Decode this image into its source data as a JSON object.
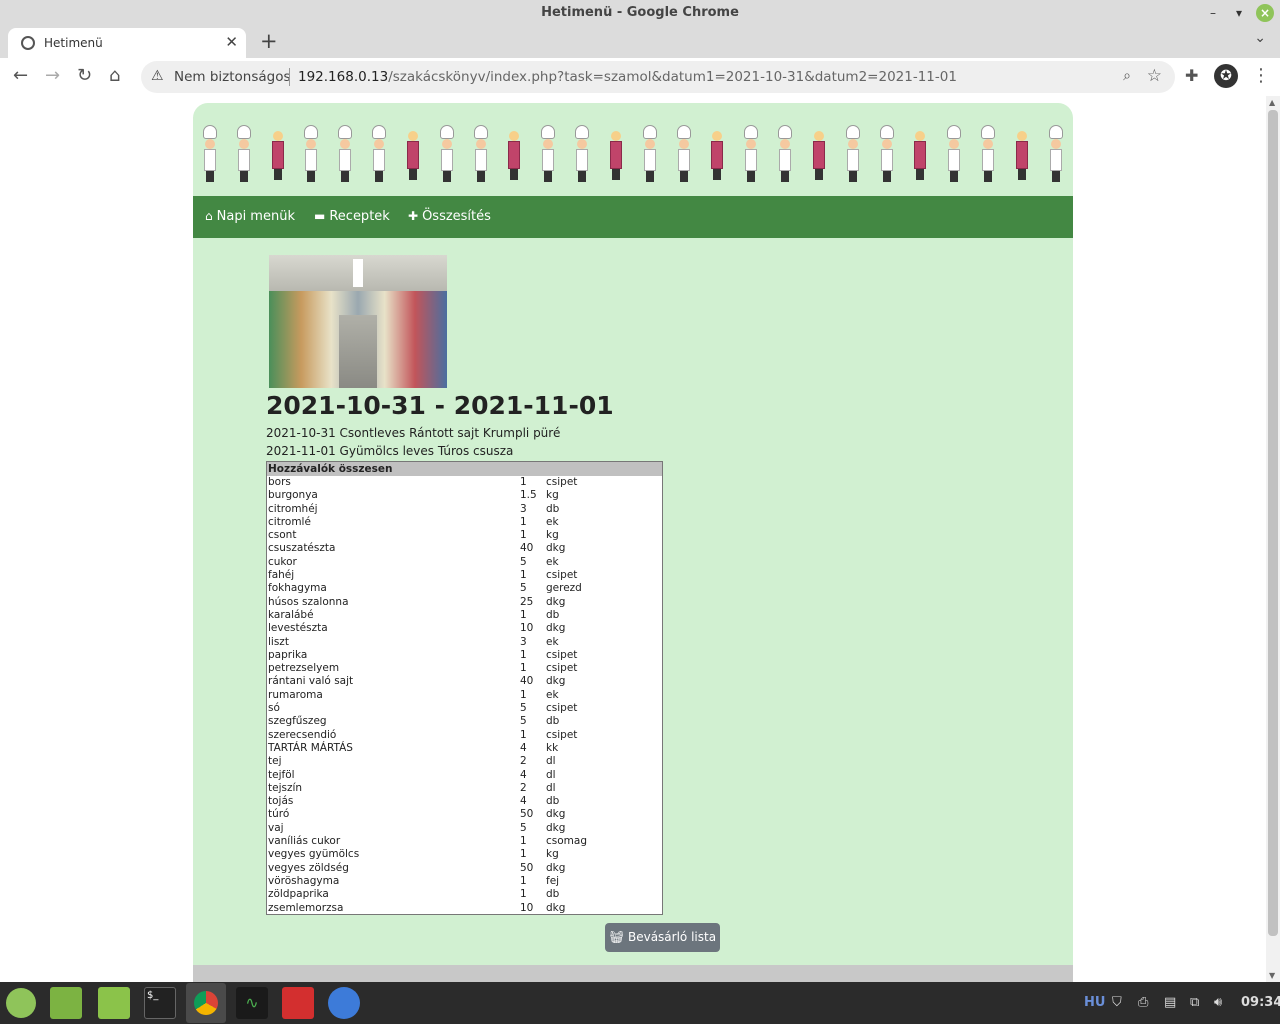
{
  "window": {
    "title": "Hetimenü - Google Chrome"
  },
  "tab": {
    "label": "Hetimenü"
  },
  "omnibox": {
    "security": "Nem biztonságos",
    "host": "192.168.0.13",
    "path": "/szakácskönyv/index.php?task=szamol&datum1=2021-10-31&datum2=2021-11-01"
  },
  "nav": {
    "daily": "Napi menük",
    "recipes": "Receptek",
    "summary": "Összesítés"
  },
  "page": {
    "heading": "2021-10-31 - 2021-11-01",
    "days": [
      "2021-10-31 Csontleves Rántott sajt Krumpli püré",
      "2021-11-01 Gyümölcs leves Túros csusza"
    ],
    "table_header": "Hozzávalók összesen",
    "ingredients": [
      {
        "name": "bors",
        "qty": "1",
        "unit": "csipet"
      },
      {
        "name": "burgonya",
        "qty": "1.5",
        "unit": "kg"
      },
      {
        "name": "citromhéj",
        "qty": "3",
        "unit": "db"
      },
      {
        "name": "citromlé",
        "qty": "1",
        "unit": "ek"
      },
      {
        "name": "csont",
        "qty": "1",
        "unit": "kg"
      },
      {
        "name": "csuszatészta",
        "qty": "40",
        "unit": "dkg"
      },
      {
        "name": "cukor",
        "qty": "5",
        "unit": "ek"
      },
      {
        "name": "fahéj",
        "qty": "1",
        "unit": "csipet"
      },
      {
        "name": "fokhagyma",
        "qty": "5",
        "unit": "gerezd"
      },
      {
        "name": "húsos szalonna",
        "qty": "25",
        "unit": "dkg"
      },
      {
        "name": "karalábé",
        "qty": "1",
        "unit": "db"
      },
      {
        "name": "levestészta",
        "qty": "10",
        "unit": "dkg"
      },
      {
        "name": "liszt",
        "qty": "3",
        "unit": "ek"
      },
      {
        "name": "paprika",
        "qty": "1",
        "unit": "csipet"
      },
      {
        "name": "petrezselyem",
        "qty": "1",
        "unit": "csipet"
      },
      {
        "name": "rántani való sajt",
        "qty": "40",
        "unit": "dkg"
      },
      {
        "name": "rumaroma",
        "qty": "1",
        "unit": "ek"
      },
      {
        "name": "só",
        "qty": "5",
        "unit": "csipet"
      },
      {
        "name": "szegfűszeg",
        "qty": "5",
        "unit": "db"
      },
      {
        "name": "szerecsendió",
        "qty": "1",
        "unit": "csipet"
      },
      {
        "name": "TARTÁR MÁRTÁS",
        "qty": "4",
        "unit": "kk"
      },
      {
        "name": "tej",
        "qty": "2",
        "unit": "dl"
      },
      {
        "name": "tejföl",
        "qty": "4",
        "unit": "dl"
      },
      {
        "name": "tejszín",
        "qty": "2",
        "unit": "dl"
      },
      {
        "name": "tojás",
        "qty": "4",
        "unit": "db"
      },
      {
        "name": "túró",
        "qty": "50",
        "unit": "dkg"
      },
      {
        "name": "vaj",
        "qty": "5",
        "unit": "dkg"
      },
      {
        "name": "vaníliás cukor",
        "qty": "1",
        "unit": "csomag"
      },
      {
        "name": "vegyes gyümölcs",
        "qty": "1",
        "unit": "kg"
      },
      {
        "name": "vegyes zöldség",
        "qty": "50",
        "unit": "dkg"
      },
      {
        "name": "vöröshagyma",
        "qty": "1",
        "unit": "fej"
      },
      {
        "name": "zöldpaprika",
        "qty": "1",
        "unit": "db"
      },
      {
        "name": "zsemlemorzsa",
        "qty": "10",
        "unit": "dkg"
      }
    ],
    "shopping_button": "Bevásárló lista"
  },
  "taskbar": {
    "lang": "HU",
    "clock": "09:34"
  }
}
